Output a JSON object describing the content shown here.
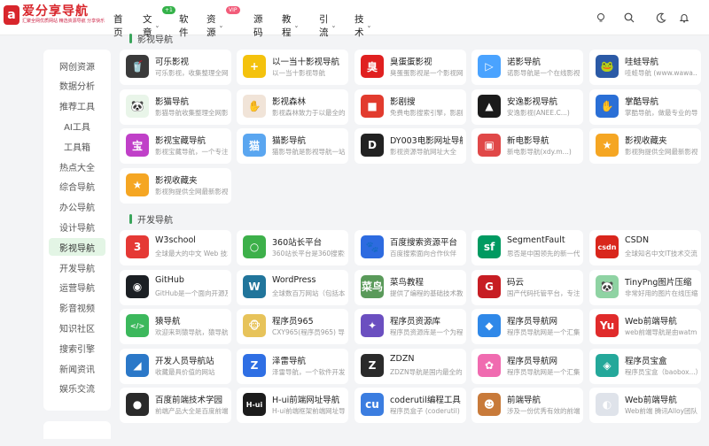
{
  "brand": {
    "logo_glyph": "a",
    "title": "爱分享导航",
    "subtitle": "汇聚全网优质网站 精选资源导航 分享快乐",
    "color": "#d8262c"
  },
  "nav": {
    "items": [
      {
        "label": "首页",
        "has_caret": false,
        "badge": ""
      },
      {
        "label": "文章",
        "has_caret": true,
        "badge": "+1"
      },
      {
        "label": "软件",
        "has_caret": false,
        "badge": ""
      },
      {
        "label": "资源",
        "has_caret": true,
        "badge": "VIP"
      },
      {
        "label": "源码",
        "has_caret": false,
        "badge": ""
      },
      {
        "label": "教程",
        "has_caret": true,
        "badge": ""
      },
      {
        "label": "引流",
        "has_caret": true,
        "badge": ""
      },
      {
        "label": "技术",
        "has_caret": true,
        "badge": ""
      }
    ],
    "tools": [
      "lightbulb-icon",
      "search-icon",
      "moon-icon",
      "bell-icon"
    ]
  },
  "sidebar": {
    "active": "影视导航",
    "items": [
      "网创资源",
      "数据分析",
      "推荐工具",
      "AI工具",
      "工具箱",
      "热点大全",
      "综合导航",
      "办公导航",
      "设计导航",
      "影视导航",
      "开发导航",
      "运营导航",
      "影音视频",
      "知识社区",
      "搜索引擎",
      "新闻资讯",
      "娱乐交流"
    ]
  },
  "sections": [
    {
      "title": "影视导航",
      "cards": [
        {
          "name": "可乐影视",
          "desc": "可乐影视，收集整理全网影视资源",
          "icon": "cola-icon",
          "glyph": "🥤",
          "color": "#3a3a3a"
        },
        {
          "name": "以一当十影视导航",
          "desc": "以一当十影视导航",
          "icon": "cross-icon",
          "glyph": "+",
          "color": "#f4c20d"
        },
        {
          "name": "臭蛋蛋影视",
          "desc": "臭蛋蛋影视是一个影视网站",
          "icon": "stinky-egg-icon",
          "glyph": "臭",
          "color": "#e02020"
        },
        {
          "name": "诺影导航",
          "desc": "诺影导航是一个在线影视导航",
          "icon": "play-icon",
          "glyph": "▷",
          "color": "#4aa3ff"
        },
        {
          "name": "哇蛙导航",
          "desc": "哇蛙导航 (www.wawa...)",
          "icon": "frog-icon",
          "glyph": "🐸",
          "color": "#2b5aa6"
        },
        {
          "name": "影猫导航",
          "desc": "影猫导航收集整理全网影视",
          "icon": "panda-icon",
          "glyph": "🐼",
          "color": "#e9f5e9"
        },
        {
          "name": "影视森林",
          "desc": "影视森林致力于以最全的资源",
          "icon": "hand-icon",
          "glyph": "✋",
          "color": "#f1e4d8"
        },
        {
          "name": "影剧搜",
          "desc": "免费电影搜索引擎，影剧搜",
          "icon": "camera-icon",
          "glyph": "■",
          "color": "#e23b2e"
        },
        {
          "name": "安逸影视导航",
          "desc": "安逸影视(ANEE.C...)",
          "icon": "arrow-up-icon",
          "glyph": "▲",
          "color": "#1b1b1b"
        },
        {
          "name": "掌酷导航",
          "desc": "掌酷导航，做最专业的导航",
          "icon": "palm-icon",
          "glyph": "✋",
          "color": "#2a6fd6"
        },
        {
          "name": "影视宝藏导航",
          "desc": "影视宝藏导航，一个专注于",
          "icon": "treasure-icon",
          "glyph": "宝",
          "color": "#c040c8"
        },
        {
          "name": "猫影导航",
          "desc": "猫影导航是影视导航一站式",
          "icon": "cat-film-icon",
          "glyph": "猫",
          "color": "#5aa6f0"
        },
        {
          "name": "DY003电影网址导航",
          "desc": "影视资源导航网址大全",
          "icon": "dy-icon",
          "glyph": "D",
          "color": "#222"
        },
        {
          "name": "新电影导航",
          "desc": "新电影导航(xdy.m...)",
          "icon": "film-icon",
          "glyph": "▣",
          "color": "#e04848"
        },
        {
          "name": "影视收藏夹",
          "desc": "影视狗提供全网最新影视",
          "icon": "star-folder-icon",
          "glyph": "★",
          "color": "#f5a623"
        },
        {
          "name": "影视收藏夹",
          "desc": "影视狗提供全网最新影视",
          "icon": "star-folder-icon",
          "glyph": "★",
          "color": "#f5a623"
        }
      ]
    },
    {
      "title": "开发导航",
      "cards": [
        {
          "name": "W3school",
          "desc": "全球最大的中文 Web 技术教程",
          "icon": "w3-icon",
          "glyph": "3",
          "color": "#e53935"
        },
        {
          "name": "360站长平台",
          "desc": "360站长平台是360搜索推出的",
          "icon": "360-icon",
          "glyph": "○",
          "color": "#3db04a"
        },
        {
          "name": "百度搜索资源平台",
          "desc": "百度搜索面向合作伙伴",
          "icon": "baidu-paw-icon",
          "glyph": "🐾",
          "color": "#2d6be0"
        },
        {
          "name": "SegmentFault",
          "desc": "思否是中国领先的新一代开发者",
          "icon": "sf-icon",
          "glyph": "sf",
          "color": "#009a61"
        },
        {
          "name": "CSDN",
          "desc": "全球知名中文IT技术交流平台",
          "icon": "csdn-icon",
          "glyph": "csdn",
          "color": "#d9261c"
        },
        {
          "name": "GitHub",
          "desc": "GitHub是一个面向开源及私有",
          "icon": "github-icon",
          "glyph": "◉",
          "color": "#1b1f23"
        },
        {
          "name": "WordPress",
          "desc": "全球数百万网站（包括本站）",
          "icon": "wordpress-icon",
          "glyph": "W",
          "color": "#21759b"
        },
        {
          "name": "菜鸟教程",
          "desc": "提供了编程的基础技术教程",
          "icon": "runoob-icon",
          "glyph": "菜鸟",
          "color": "#5a9a5a"
        },
        {
          "name": "码云",
          "desc": "国产代码托管平台，专注于",
          "icon": "gitee-icon",
          "glyph": "G",
          "color": "#c71d23"
        },
        {
          "name": "TinyPng图片压缩",
          "desc": "非常好用的图片在线压缩",
          "icon": "panda-icon",
          "glyph": "🐼",
          "color": "#8fd3a3"
        },
        {
          "name": "猿导航",
          "desc": "欢迎来到猿导航，猿导航是",
          "icon": "code-bubble-icon",
          "glyph": "</>",
          "color": "#3cb85c"
        },
        {
          "name": "程序员965",
          "desc": "CXY965(程序员965) 导航站",
          "icon": "monkey-icon",
          "glyph": "🐵",
          "color": "#e7c35a"
        },
        {
          "name": "程序员资源库",
          "desc": "程序员资源库是一个为程序员",
          "icon": "puzzle-icon",
          "glyph": "✦",
          "color": "#6b4fc0"
        },
        {
          "name": "程序员导航网",
          "desc": "程序员导航网是一个汇集",
          "icon": "cube-icon",
          "glyph": "◆",
          "color": "#2f88e8"
        },
        {
          "name": "Web前端导航",
          "desc": "web前端导航是由watmen",
          "icon": "yu-icon",
          "glyph": "Yu",
          "color": "#e02b2b"
        },
        {
          "name": "开发人员导航站",
          "desc": "收藏最具价值的网站",
          "icon": "dev-nav-icon",
          "glyph": "◢",
          "color": "#2b78c8"
        },
        {
          "name": "泽雷导航",
          "desc": "泽雷导航，一个软件开发",
          "icon": "z-icon",
          "glyph": "Z",
          "color": "#2f6fe4"
        },
        {
          "name": "ZDZN",
          "desc": "ZDZN导航是国内最全的开发",
          "icon": "zdzn-icon",
          "glyph": "Z",
          "color": "#2b2b2b"
        },
        {
          "name": "程序员导航网",
          "desc": "程序员导航网是一个汇集",
          "icon": "flower-icon",
          "glyph": "✿",
          "color": "#f06bb0"
        },
        {
          "name": "程序员宝盒",
          "desc": "程序员宝盒（baobox...）",
          "icon": "box-icon",
          "glyph": "◈",
          "color": "#24a89a"
        },
        {
          "name": "百度前端技术学园",
          "desc": "前端产品大全是百度前端",
          "icon": "planet-icon",
          "glyph": "●",
          "color": "#2a2a2a"
        },
        {
          "name": "H-ui前端网址导航",
          "desc": "H-ui前端框架前端网址导航",
          "icon": "hui-icon",
          "glyph": "H-ui",
          "color": "#1c1c1c"
        },
        {
          "name": "coderutil编程工具",
          "desc": "程序员盒子 (coderutil)",
          "icon": "coderutil-icon",
          "glyph": "cu",
          "color": "#3b7de0"
        },
        {
          "name": "前端导航",
          "desc": "涉及一份优秀有效的前端",
          "icon": "pixel-people-icon",
          "glyph": "☻",
          "color": "#c87a3a"
        },
        {
          "name": "Web前端导航",
          "desc": "Web前端 腾讯Alloy团队",
          "icon": "ghost-icon",
          "glyph": "◐",
          "color": "#dfe3ea"
        }
      ]
    }
  ]
}
